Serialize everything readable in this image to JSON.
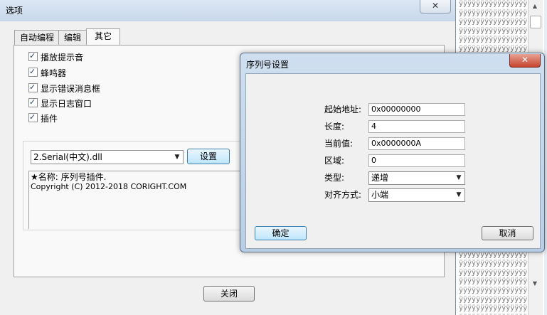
{
  "options_window": {
    "title": "选项",
    "close_glyph": "✕",
    "tabs": [
      "自动编程",
      "编辑",
      "其它"
    ],
    "checkboxes": [
      {
        "label": "播放提示音",
        "checked": true
      },
      {
        "label": "蜂鸣器",
        "checked": true
      },
      {
        "label": "显示错误消息框",
        "checked": true
      },
      {
        "label": "显示日志窗口",
        "checked": true
      },
      {
        "label": "插件",
        "checked": true
      }
    ],
    "plugin_select": "2.Serial(中文).dll",
    "settings_button": "设置",
    "plugin_info": {
      "name": "★名称: 序列号插件.",
      "copyright": "Copyright (C) 2012-2018 CORIGHT.COM"
    },
    "close_button": "关闭"
  },
  "dialog": {
    "title": "序列号设置",
    "close_glyph": "✕",
    "fields": {
      "start_label": "起始地址:",
      "start_value": "0x00000000",
      "length_label": "长度:",
      "length_value": "4",
      "current_label": "当前值:",
      "current_value": "0x0000000A",
      "area_label": "区域:",
      "area_value": "0",
      "type_label": "类型:",
      "type_value": "递增",
      "align_label": "对齐方式:",
      "align_value": "小端"
    },
    "ok_button": "确定",
    "cancel_button": "取消"
  },
  "hex_view_glyph": "ÿ"
}
